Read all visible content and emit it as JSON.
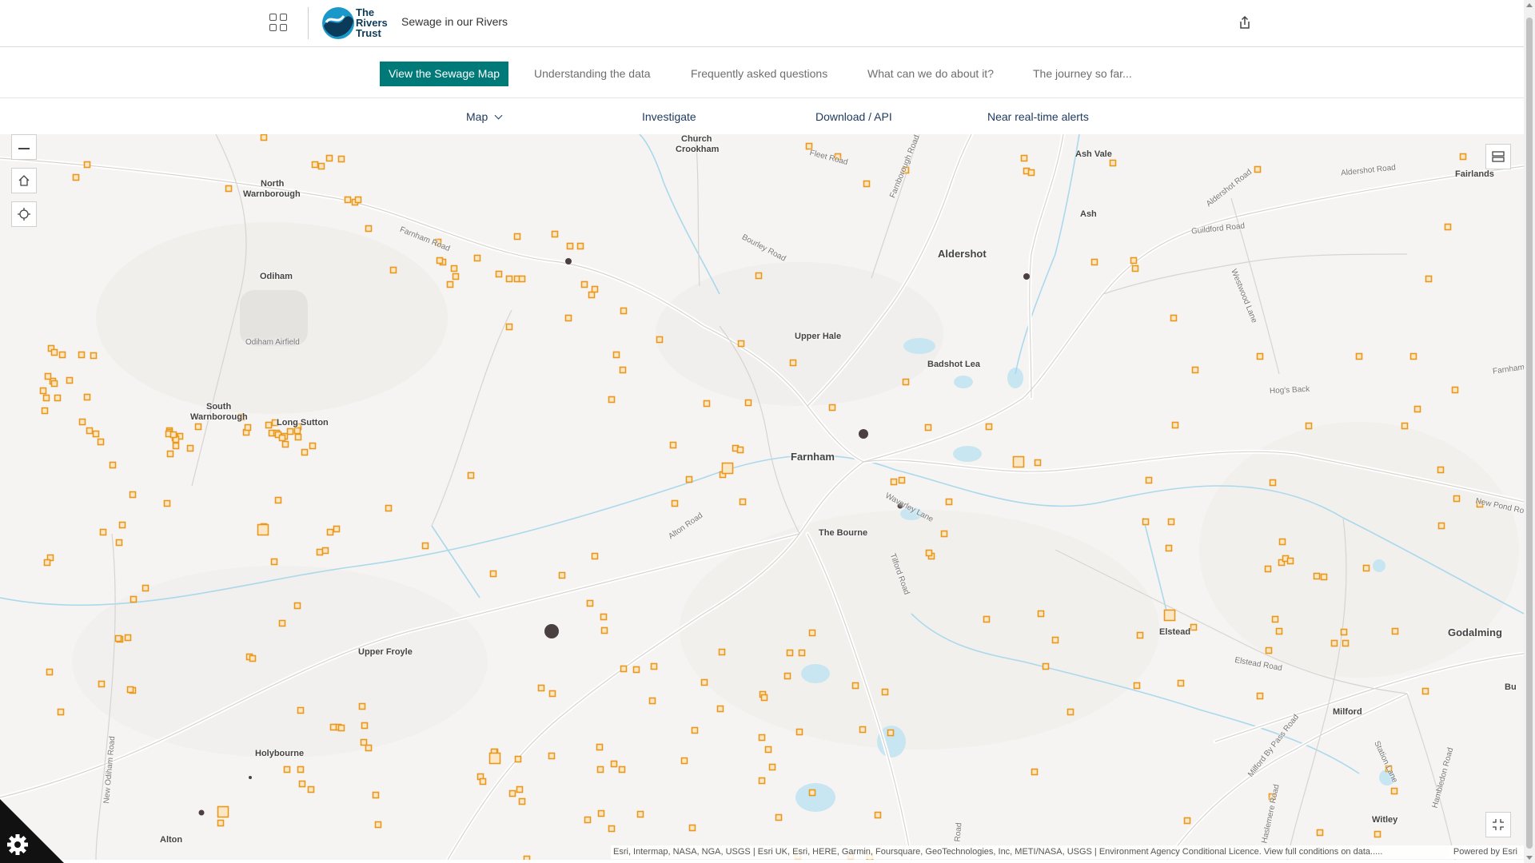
{
  "header": {
    "logo_text_line1": "The",
    "logo_text_line2": "Rivers",
    "logo_text_line3": "Trust",
    "site_title": "Sewage in our Rivers",
    "apps_icon": "apps-grid-icon",
    "share_icon": "share-icon"
  },
  "nav": {
    "active": "View the Sewage Map",
    "items": [
      "Understanding the data",
      "Frequently asked questions",
      "What can we do about it?",
      "The journey so far..."
    ]
  },
  "subnav": {
    "map_label": "Map",
    "investigate": "Investigate",
    "download": "Download / API",
    "alerts": "Near real-time alerts"
  },
  "map": {
    "labels": {
      "church_crookham_1": "Church",
      "church_crookham_2": "Crookham",
      "ash_vale": "Ash Vale",
      "fairlands": "Fairlands",
      "north_warnborough_1": "North",
      "north_warnborough_2": "Warnborough",
      "ash": "Ash",
      "aldershot": "Aldershot",
      "odiham": "Odiham",
      "odiham_airfield": "Odiham Airfield",
      "upper_hale": "Upper Hale",
      "badshot_lea": "Badshot Lea",
      "south_warnborough_1": "South",
      "south_warnborough_2": "Warnborough",
      "long_sutton": "Long Sutton",
      "farnham": "Farnham",
      "the_bourne": "The Bourne",
      "upper_froyle": "Upper Froyle",
      "elstead": "Elstead",
      "godalming": "Godalming",
      "milford": "Milford",
      "holybourne": "Holybourne",
      "alton": "Alton",
      "witley": "Witley",
      "bu": "Bu"
    },
    "roads": {
      "fleet_road": "Fleet Road",
      "farnborough_road": "Farnborough Road",
      "bourley_road": "Bourley Road",
      "farnham_road": "Farnham Road",
      "guildford_road": "Guildford Road",
      "aldershot_road": "Aldershot Road",
      "aldershot_road_2": "Aldershot Road",
      "westwood_lane": "Westwood Lane",
      "hogs_back": "Hog's Back",
      "farnham_e": "Farnham",
      "waverley_lane": "Waverley Lane",
      "alton_road": "Alton Road",
      "tilford_road": "Tilford Road",
      "new_pond_road": "New Pond Ro",
      "elstead_road": "Elstead Road",
      "new_odiham_road": "New Odiham Road",
      "milford_bypass": "Milford By Pass Road",
      "station_lane": "Station Lane",
      "hambledon_road": "Hambledon Road",
      "haslemere_road": "Haslemere Road",
      "tilford_road_2": "Road"
    },
    "attribution": "Esri, Intermap, NASA, NGA, USGS | Esri UK, Esri, HERE, Garmin, Foursquare, GeoTechnologies, Inc, METI/NASA, USGS | Environment Agency Conditional Licence. View full conditions on data.....",
    "powered_by": "Powered by Esri",
    "controls": {
      "zoom_out": "zoom-out-icon",
      "home": "home-icon",
      "locate": "locate-icon",
      "basemap": "basemap-icon",
      "fullscreen": "fullscreen-icon"
    },
    "colors": {
      "overflow_marker": "#e8991d",
      "spill_event": "#4a4040",
      "water": "#c7e6f2",
      "teal_accent": "#007a78"
    }
  },
  "cookie_icon": "cookie-settings-gear-icon"
}
